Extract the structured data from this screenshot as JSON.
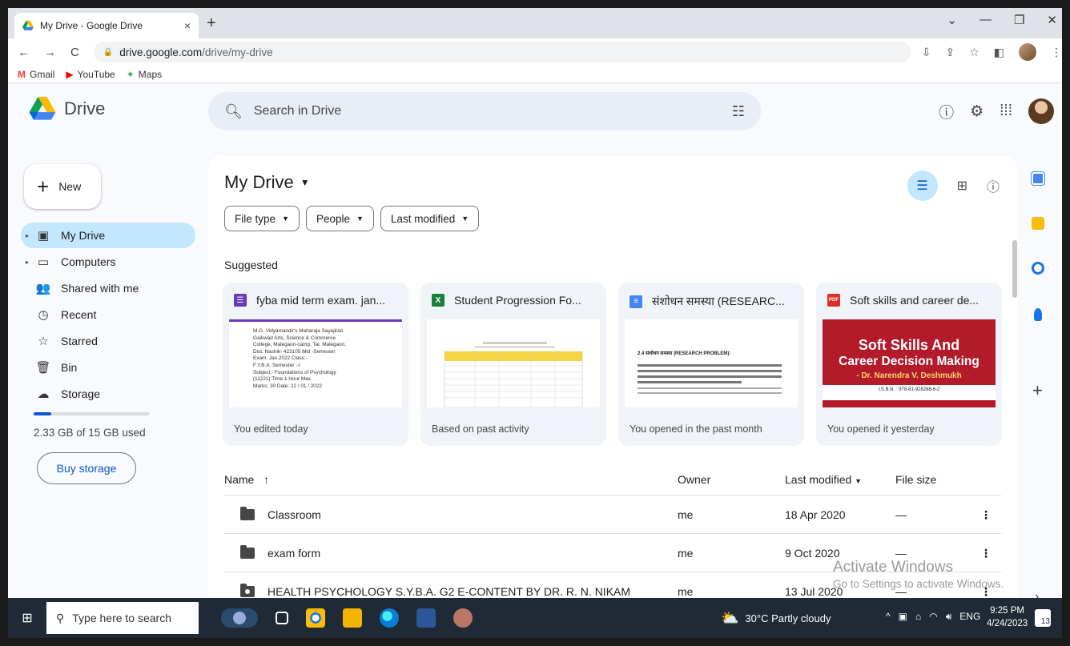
{
  "browser": {
    "tab_title": "My Drive - Google Drive",
    "tab_close": "×",
    "new_tab": "+",
    "url_host": "drive.google.com",
    "url_path": "/drive/my-drive",
    "bookmarks": [
      "Gmail",
      "YouTube",
      "Maps"
    ],
    "window_controls": [
      "⌄",
      "—",
      "❐",
      "✕"
    ]
  },
  "drive": {
    "app_name": "Drive",
    "search_placeholder": "Search in Drive",
    "new_label": "New",
    "nav": [
      {
        "label": "My Drive",
        "icon": "drive-icon",
        "glyph": "▣",
        "active": true
      },
      {
        "label": "Computers",
        "icon": "computer-icon",
        "glyph": "▭"
      },
      {
        "label": "Shared with me",
        "icon": "people-icon",
        "glyph": "👥"
      },
      {
        "label": "Recent",
        "icon": "clock-icon",
        "glyph": "◷"
      },
      {
        "label": "Starred",
        "icon": "star-icon",
        "glyph": "☆"
      },
      {
        "label": "Bin",
        "icon": "trash-icon",
        "glyph": "🗑"
      },
      {
        "label": "Storage",
        "icon": "cloud-icon",
        "glyph": "☁"
      }
    ],
    "storage_used_fraction": 0.155,
    "storage_text": "2.33 GB of 15 GB used",
    "buy_storage": "Buy storage",
    "page_title": "My Drive",
    "filters": [
      "File type",
      "People",
      "Last modified"
    ],
    "suggested_label": "Suggested",
    "cards": [
      {
        "name": "fyba mid term exam. jan...",
        "type_color": "#673ab7",
        "type_glyph": "☰",
        "footer": "You edited today",
        "thumb_lines": [
          "M.G. Vidyamandir's Maharaja Sayajirao",
          "Gaikwad Arts, Science & Commerce",
          "College, Malegaon-camp, Tal. Malegaon,",
          "Dist. Nashik- 423105     Mid -Semester",
          "Exam. Jan.2022          Class:-",
          "F.Y.B.A.          Semester :-I",
          "Subject:- Foundations of Psychology",
          "(11221) Time:1 Hour              Max.",
          "Marks: 30      Date:  22 / 01 / 2022"
        ]
      },
      {
        "name": "Student Progression Fo...",
        "type_color": "#188038",
        "type_glyph": "X",
        "footer": "Based on past activity"
      },
      {
        "name": "संशोधन समस्या (RESEARC...",
        "type_color": "#4285f4",
        "type_glyph": "≡",
        "footer": "You opened in the past month",
        "thumb_lines": [
          "2.4 संशोधन समस्या (RESEARCH PROBLEM):"
        ]
      },
      {
        "name": "Soft skills and career de...",
        "type_color": "#d93025",
        "type_glyph": "PDF",
        "footer": "You opened it yesterday",
        "thumb_lines": [
          "Soft Skills And",
          "Career Decision Making",
          "- Dr. Narendra V. Deshmukh",
          "I.S.B.N. : 978-81-928288-6-2"
        ]
      }
    ],
    "columns": {
      "name": "Name",
      "owner": "Owner",
      "modified": "Last modified",
      "size": "File size"
    },
    "rows": [
      {
        "name": "Classroom",
        "owner": "me",
        "modified": "18 Apr 2020",
        "size": "—",
        "shared": false
      },
      {
        "name": "exam form",
        "owner": "me",
        "modified": "9 Oct 2020",
        "size": "—",
        "shared": false
      },
      {
        "name": "HEALTH PSYCHOLOGY S.Y.B.A. G2  E-CONTENT BY DR. R. N. NIKAM",
        "owner": "me",
        "modified": "13 Jul 2020",
        "size": "—",
        "shared": true
      }
    ]
  },
  "watermark": {
    "line1": "Activate Windows",
    "line2": "Go to Settings to activate Windows."
  },
  "taskbar": {
    "search_placeholder": "Type here to search",
    "weather": "30°C  Partly cloudy",
    "lang": "ENG",
    "time": "9:25 PM",
    "date": "4/24/2023",
    "notifications": "13"
  },
  "colors": {
    "accent": "#0b57d0",
    "active_nav": "#c2e7ff"
  }
}
